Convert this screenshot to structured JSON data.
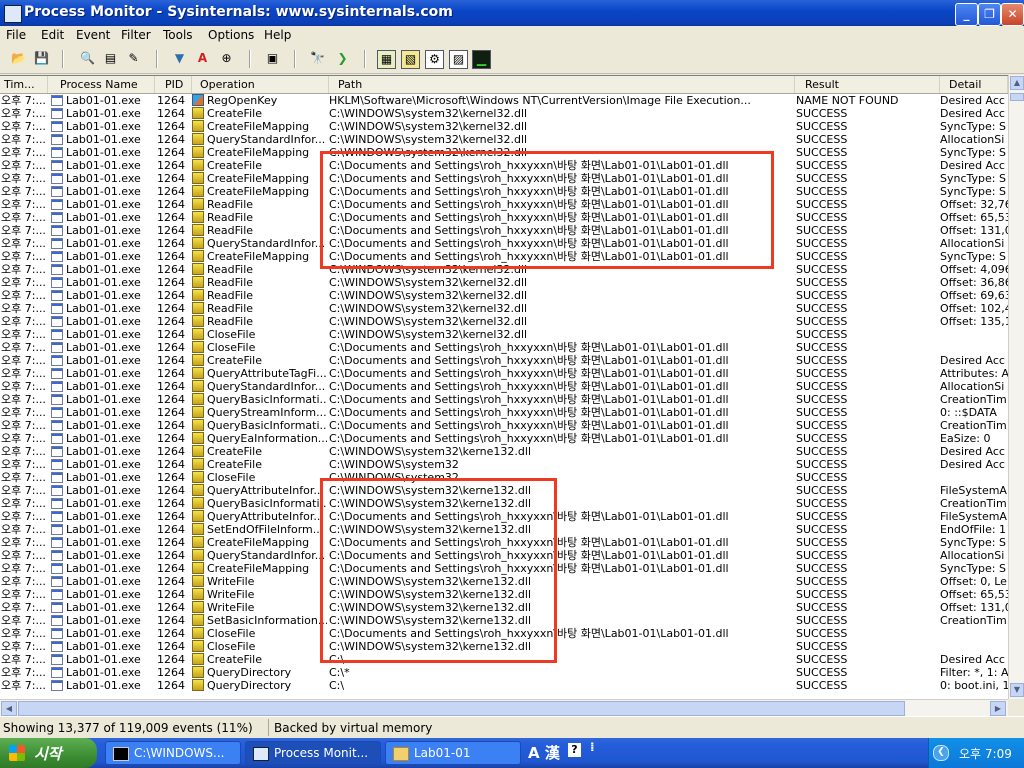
{
  "window": {
    "title": "Process Monitor - Sysinternals: www.sysinternals.com",
    "minimize": "_",
    "maximize": "❐",
    "close": "✕"
  },
  "menu": [
    "File",
    "Edit",
    "Event",
    "Filter",
    "Tools",
    "Options",
    "Help"
  ],
  "toolbar": {
    "icons": [
      "open-icon",
      "save-icon",
      "magnify-icon",
      "autoscroll-icon",
      "clear-icon",
      "filter-icon",
      "highlight-icon",
      "target-icon",
      "jump-icon",
      "find-icon",
      "tree-icon",
      "registry-activity-icon",
      "file-activity-icon",
      "network-activity-icon",
      "process-activity-icon",
      "profiling-icon"
    ]
  },
  "columns": [
    "Tim...",
    "Process Name",
    "PID",
    "Operation",
    "Path",
    "Result",
    "Detail"
  ],
  "rows": [
    [
      "오후 7:...",
      "Lab01-01.exe",
      "1264",
      "reg",
      "RegOpenKey",
      "HKLM\\Software\\Microsoft\\Windows NT\\CurrentVersion\\Image File Execution...",
      "NAME NOT FOUND",
      "Desired Acc"
    ],
    [
      "오후 7:...",
      "Lab01-01.exe",
      "1264",
      "file",
      "CreateFile",
      "C:\\WINDOWS\\system32\\kernel32.dll",
      "SUCCESS",
      "Desired Acc"
    ],
    [
      "오후 7:...",
      "Lab01-01.exe",
      "1264",
      "file",
      "CreateFileMapping",
      "C:\\WINDOWS\\system32\\kernel32.dll",
      "SUCCESS",
      "SyncType: S"
    ],
    [
      "오후 7:...",
      "Lab01-01.exe",
      "1264",
      "file",
      "QueryStandardInfor...",
      "C:\\WINDOWS\\system32\\kernel32.dll",
      "SUCCESS",
      "AllocationSi"
    ],
    [
      "오후 7:...",
      "Lab01-01.exe",
      "1264",
      "file",
      "CreateFileMapping",
      "C:\\WINDOWS\\system32\\kernel32.dll",
      "SUCCESS",
      "SyncType: S"
    ],
    [
      "오후 7:...",
      "Lab01-01.exe",
      "1264",
      "file",
      "CreateFile",
      "C:\\Documents and Settings\\roh_hxxyxxn\\바탕 화면\\Lab01-01\\Lab01-01.dll",
      "SUCCESS",
      "Desired Acc"
    ],
    [
      "오후 7:...",
      "Lab01-01.exe",
      "1264",
      "file",
      "CreateFileMapping",
      "C:\\Documents and Settings\\roh_hxxyxxn\\바탕 화면\\Lab01-01\\Lab01-01.dll",
      "SUCCESS",
      "SyncType: S"
    ],
    [
      "오후 7:...",
      "Lab01-01.exe",
      "1264",
      "file",
      "CreateFileMapping",
      "C:\\Documents and Settings\\roh_hxxyxxn\\바탕 화면\\Lab01-01\\Lab01-01.dll",
      "SUCCESS",
      "SyncType: S"
    ],
    [
      "오후 7:...",
      "Lab01-01.exe",
      "1264",
      "file",
      "ReadFile",
      "C:\\Documents and Settings\\roh_hxxyxxn\\바탕 화면\\Lab01-01\\Lab01-01.dll",
      "SUCCESS",
      "Offset: 32,76"
    ],
    [
      "오후 7:...",
      "Lab01-01.exe",
      "1264",
      "file",
      "ReadFile",
      "C:\\Documents and Settings\\roh_hxxyxxn\\바탕 화면\\Lab01-01\\Lab01-01.dll",
      "SUCCESS",
      "Offset: 65,53"
    ],
    [
      "오후 7:...",
      "Lab01-01.exe",
      "1264",
      "file",
      "ReadFile",
      "C:\\Documents and Settings\\roh_hxxyxxn\\바탕 화면\\Lab01-01\\Lab01-01.dll",
      "SUCCESS",
      "Offset: 131,0"
    ],
    [
      "오후 7:...",
      "Lab01-01.exe",
      "1264",
      "file",
      "QueryStandardInfor...",
      "C:\\Documents and Settings\\roh_hxxyxxn\\바탕 화면\\Lab01-01\\Lab01-01.dll",
      "SUCCESS",
      "AllocationSi"
    ],
    [
      "오후 7:...",
      "Lab01-01.exe",
      "1264",
      "file",
      "CreateFileMapping",
      "C:\\Documents and Settings\\roh_hxxyxxn\\바탕 화면\\Lab01-01\\Lab01-01.dll",
      "SUCCESS",
      "SyncType: S"
    ],
    [
      "오후 7:...",
      "Lab01-01.exe",
      "1264",
      "file",
      "ReadFile",
      "C:\\WINDOWS\\system32\\kernel32.dll",
      "SUCCESS",
      "Offset: 4,096"
    ],
    [
      "오후 7:...",
      "Lab01-01.exe",
      "1264",
      "file",
      "ReadFile",
      "C:\\WINDOWS\\system32\\kernel32.dll",
      "SUCCESS",
      "Offset: 36,86"
    ],
    [
      "오후 7:...",
      "Lab01-01.exe",
      "1264",
      "file",
      "ReadFile",
      "C:\\WINDOWS\\system32\\kernel32.dll",
      "SUCCESS",
      "Offset: 69,63"
    ],
    [
      "오후 7:...",
      "Lab01-01.exe",
      "1264",
      "file",
      "ReadFile",
      "C:\\WINDOWS\\system32\\kernel32.dll",
      "SUCCESS",
      "Offset: 102,4"
    ],
    [
      "오후 7:...",
      "Lab01-01.exe",
      "1264",
      "file",
      "ReadFile",
      "C:\\WINDOWS\\system32\\kernel32.dll",
      "SUCCESS",
      "Offset: 135,1"
    ],
    [
      "오후 7:...",
      "Lab01-01.exe",
      "1264",
      "file",
      "CloseFile",
      "C:\\WINDOWS\\system32\\kernel32.dll",
      "SUCCESS",
      ""
    ],
    [
      "오후 7:...",
      "Lab01-01.exe",
      "1264",
      "file",
      "CloseFile",
      "C:\\Documents and Settings\\roh_hxxyxxn\\바탕 화면\\Lab01-01\\Lab01-01.dll",
      "SUCCESS",
      ""
    ],
    [
      "오후 7:...",
      "Lab01-01.exe",
      "1264",
      "file",
      "CreateFile",
      "C:\\Documents and Settings\\roh_hxxyxxn\\바탕 화면\\Lab01-01\\Lab01-01.dll",
      "SUCCESS",
      "Desired Acc"
    ],
    [
      "오후 7:...",
      "Lab01-01.exe",
      "1264",
      "file",
      "QueryAttributeTagFi...",
      "C:\\Documents and Settings\\roh_hxxyxxn\\바탕 화면\\Lab01-01\\Lab01-01.dll",
      "SUCCESS",
      "Attributes: A"
    ],
    [
      "오후 7:...",
      "Lab01-01.exe",
      "1264",
      "file",
      "QueryStandardInfor...",
      "C:\\Documents and Settings\\roh_hxxyxxn\\바탕 화면\\Lab01-01\\Lab01-01.dll",
      "SUCCESS",
      "AllocationSi"
    ],
    [
      "오후 7:...",
      "Lab01-01.exe",
      "1264",
      "file",
      "QueryBasicInformati...",
      "C:\\Documents and Settings\\roh_hxxyxxn\\바탕 화면\\Lab01-01\\Lab01-01.dll",
      "SUCCESS",
      "CreationTim"
    ],
    [
      "오후 7:...",
      "Lab01-01.exe",
      "1264",
      "file",
      "QueryStreamInform...",
      "C:\\Documents and Settings\\roh_hxxyxxn\\바탕 화면\\Lab01-01\\Lab01-01.dll",
      "SUCCESS",
      "0: ::$DATA"
    ],
    [
      "오후 7:...",
      "Lab01-01.exe",
      "1264",
      "file",
      "QueryBasicInformati...",
      "C:\\Documents and Settings\\roh_hxxyxxn\\바탕 화면\\Lab01-01\\Lab01-01.dll",
      "SUCCESS",
      "CreationTim"
    ],
    [
      "오후 7:...",
      "Lab01-01.exe",
      "1264",
      "file",
      "QueryEaInformation...",
      "C:\\Documents and Settings\\roh_hxxyxxn\\바탕 화면\\Lab01-01\\Lab01-01.dll",
      "SUCCESS",
      "EaSize: 0"
    ],
    [
      "오후 7:...",
      "Lab01-01.exe",
      "1264",
      "file",
      "CreateFile",
      "C:\\WINDOWS\\system32\\kerne132.dll",
      "SUCCESS",
      "Desired Acc"
    ],
    [
      "오후 7:...",
      "Lab01-01.exe",
      "1264",
      "file",
      "CreateFile",
      "C:\\WINDOWS\\system32",
      "SUCCESS",
      "Desired Acc"
    ],
    [
      "오후 7:...",
      "Lab01-01.exe",
      "1264",
      "file",
      "CloseFile",
      "C:\\WINDOWS\\system32",
      "SUCCESS",
      ""
    ],
    [
      "오후 7:...",
      "Lab01-01.exe",
      "1264",
      "file",
      "QueryAttributeInfor...",
      "C:\\WINDOWS\\system32\\kerne132.dll",
      "SUCCESS",
      "FileSystemA"
    ],
    [
      "오후 7:...",
      "Lab01-01.exe",
      "1264",
      "file",
      "QueryBasicInformati...",
      "C:\\WINDOWS\\system32\\kerne132.dll",
      "SUCCESS",
      "CreationTim"
    ],
    [
      "오후 7:...",
      "Lab01-01.exe",
      "1264",
      "file",
      "QueryAttributeInfor...",
      "C:\\Documents and Settings\\roh_hxxyxxn\\바탕 화면\\Lab01-01\\Lab01-01.dll",
      "SUCCESS",
      "FileSystemA"
    ],
    [
      "오후 7:...",
      "Lab01-01.exe",
      "1264",
      "file",
      "SetEndOfFileInform...",
      "C:\\WINDOWS\\system32\\kerne132.dll",
      "SUCCESS",
      "EndOfFile: 1"
    ],
    [
      "오후 7:...",
      "Lab01-01.exe",
      "1264",
      "file",
      "CreateFileMapping",
      "C:\\Documents and Settings\\roh_hxxyxxn\\바탕 화면\\Lab01-01\\Lab01-01.dll",
      "SUCCESS",
      "SyncType: S"
    ],
    [
      "오후 7:...",
      "Lab01-01.exe",
      "1264",
      "file",
      "QueryStandardInfor...",
      "C:\\Documents and Settings\\roh_hxxyxxn\\바탕 화면\\Lab01-01\\Lab01-01.dll",
      "SUCCESS",
      "AllocationSi"
    ],
    [
      "오후 7:...",
      "Lab01-01.exe",
      "1264",
      "file",
      "CreateFileMapping",
      "C:\\Documents and Settings\\roh_hxxyxxn\\바탕 화면\\Lab01-01\\Lab01-01.dll",
      "SUCCESS",
      "SyncType: S"
    ],
    [
      "오후 7:...",
      "Lab01-01.exe",
      "1264",
      "file",
      "WriteFile",
      "C:\\WINDOWS\\system32\\kerne132.dll",
      "SUCCESS",
      "Offset: 0, Le"
    ],
    [
      "오후 7:...",
      "Lab01-01.exe",
      "1264",
      "file",
      "WriteFile",
      "C:\\WINDOWS\\system32\\kerne132.dll",
      "SUCCESS",
      "Offset: 65,53"
    ],
    [
      "오후 7:...",
      "Lab01-01.exe",
      "1264",
      "file",
      "WriteFile",
      "C:\\WINDOWS\\system32\\kerne132.dll",
      "SUCCESS",
      "Offset: 131,0"
    ],
    [
      "오후 7:...",
      "Lab01-01.exe",
      "1264",
      "file",
      "SetBasicInformation...",
      "C:\\WINDOWS\\system32\\kerne132.dll",
      "SUCCESS",
      "CreationTim"
    ],
    [
      "오후 7:...",
      "Lab01-01.exe",
      "1264",
      "file",
      "CloseFile",
      "C:\\Documents and Settings\\roh_hxxyxxn\\바탕 화면\\Lab01-01\\Lab01-01.dll",
      "SUCCESS",
      ""
    ],
    [
      "오후 7:...",
      "Lab01-01.exe",
      "1264",
      "file",
      "CloseFile",
      "C:\\WINDOWS\\system32\\kerne132.dll",
      "SUCCESS",
      ""
    ],
    [
      "오후 7:...",
      "Lab01-01.exe",
      "1264",
      "file",
      "CreateFile",
      "C:\\",
      "SUCCESS",
      "Desired Acc"
    ],
    [
      "오후 7:...",
      "Lab01-01.exe",
      "1264",
      "file",
      "QueryDirectory",
      "C:\\*",
      "SUCCESS",
      "Filter: *, 1: A"
    ],
    [
      "오후 7:...",
      "Lab01-01.exe",
      "1264",
      "file",
      "QueryDirectory",
      "C:\\",
      "SUCCESS",
      "0: boot.ini, 1"
    ]
  ],
  "status": {
    "showing": "Showing 13,377 of 119,009 events (11%)",
    "backing": "Backed by virtual memory"
  },
  "taskbar": {
    "start": "시작",
    "tasks": [
      "C:\\WINDOWS...",
      "Process Monit...",
      "Lab01-01"
    ],
    "ime": "A 漢",
    "ime_help": "?",
    "clock": "오후 7:09"
  },
  "colors": {
    "highlight": "#ee3a22",
    "titlebar": "#0a46c8"
  }
}
